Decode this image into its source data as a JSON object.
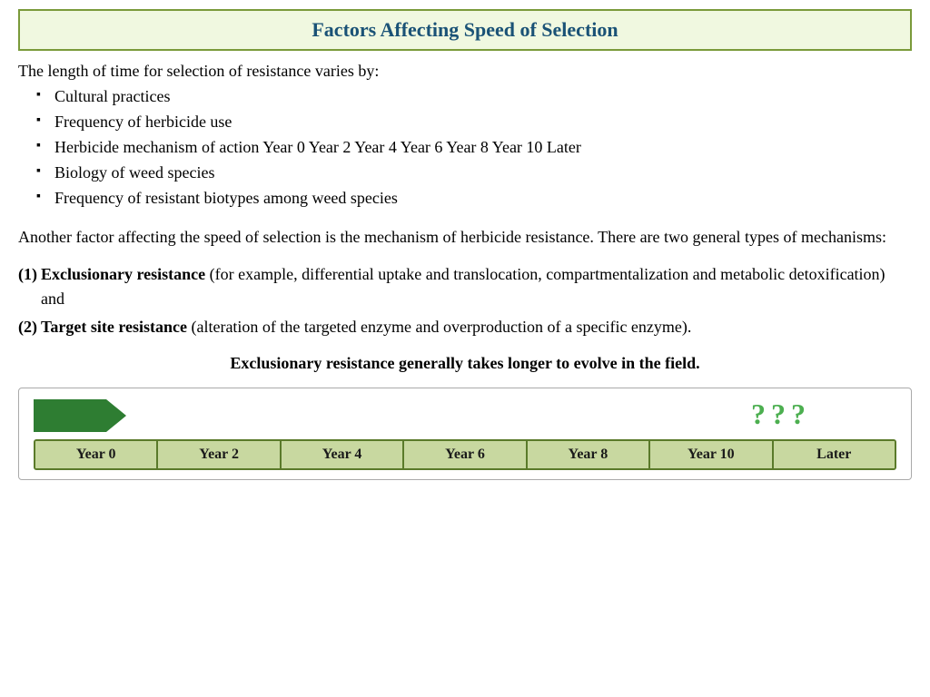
{
  "title": "Factors Affecting Speed of Selection",
  "intro": "The length of time for selection of resistance varies by:",
  "bullets": [
    "Cultural practices",
    "Frequency of herbicide use",
    "Herbicide mechanism of action Year 0 Year 2 Year 4 Year 6 Year 8 Year 10 Later",
    "Biology of weed species",
    "Frequency of resistant biotypes among weed species"
  ],
  "paragraph1": "Another factor affecting the speed of selection is the mechanism of herbicide resistance. There are two general types of mechanisms:",
  "item1_num": "(1)",
  "item1_bold": "Exclusionary resistance",
  "item1_rest": " (for example, differential uptake and translocation, compartmentalization and metabolic detoxification) and",
  "item2_num": "(2)",
  "item2_bold": "Target site resistance",
  "item2_rest": " (alteration of the targeted enzyme and overproduction of a specific enzyme).",
  "highlight": "Exclusionary resistance generally takes longer to evolve in the field.",
  "timeline_labels": [
    "Year 0",
    "Year 2",
    "Year 4",
    "Year 6",
    "Year 8",
    "Year 10",
    "Later"
  ],
  "question_marks": "? ? ?"
}
